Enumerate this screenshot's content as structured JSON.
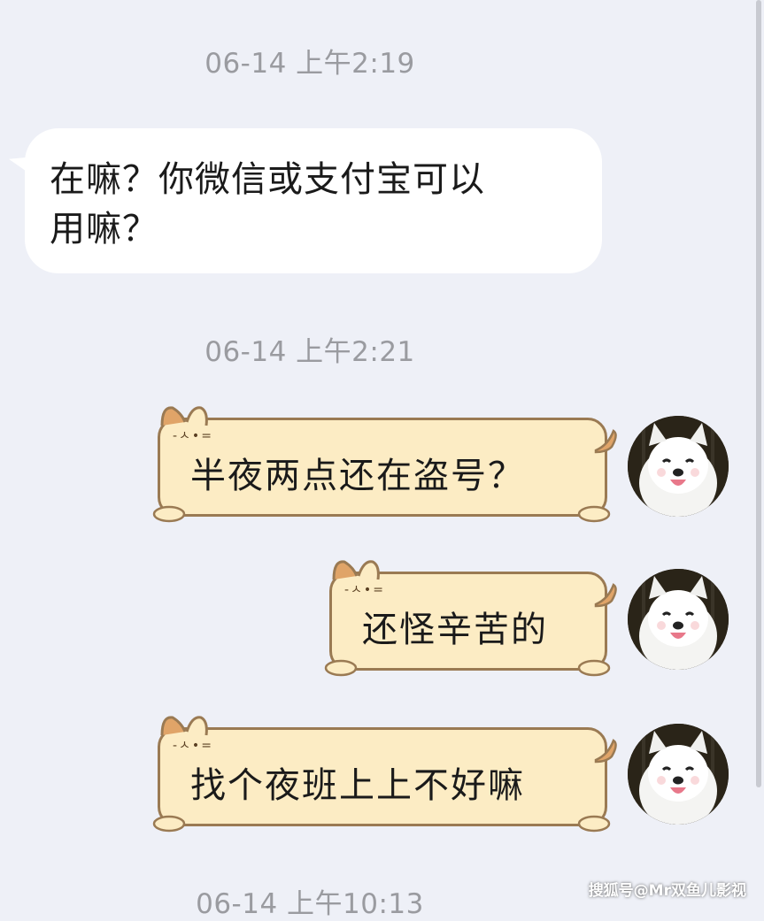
{
  "messages": [
    {
      "type": "time",
      "text": "06-14 上午2:19"
    },
    {
      "type": "incoming",
      "line1": "在嘛？你微信或支付宝可以",
      "line2": "用嘛？"
    },
    {
      "type": "time",
      "text": "06-14 上午2:21"
    },
    {
      "type": "outgoing",
      "text": "半夜两点还在盗号？",
      "avatar": "samoyed-dog-avatar"
    },
    {
      "type": "outgoing",
      "text": "还怪辛苦的",
      "avatar": "samoyed-dog-avatar"
    },
    {
      "type": "outgoing",
      "text": "找个夜班上上不好嘛",
      "avatar": "samoyed-dog-avatar"
    },
    {
      "type": "time",
      "text": "06-14 上午10:13"
    }
  ],
  "watermark": "搜狐号@Mr双鱼儿影视",
  "colors": {
    "background": "#eef0f7",
    "incoming_bubble": "#ffffff",
    "cat_bubble_fill": "#fcecc4",
    "cat_bubble_border": "#9a7a53",
    "cat_ear": "#e0a468",
    "timestamp": "#9a9ba0"
  }
}
